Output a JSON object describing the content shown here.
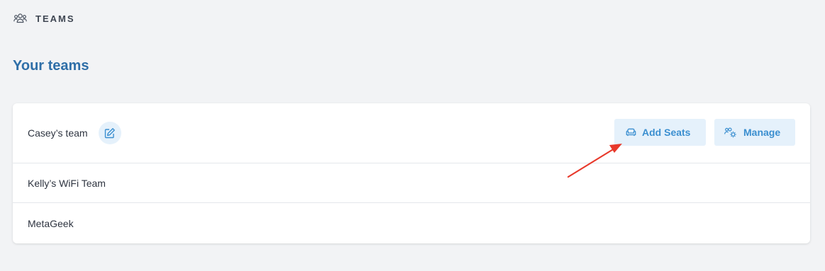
{
  "header": {
    "title": "TEAMS",
    "icon": "users-icon"
  },
  "section": {
    "title": "Your teams"
  },
  "teams": [
    {
      "name": "Casey’s team"
    },
    {
      "name": "Kelly’s WiFi Team"
    },
    {
      "name": "MetaGeek"
    }
  ],
  "actions": {
    "add_seats_label": "Add Seats",
    "add_seats_icon": "sofa-seat-icon",
    "manage_label": "Manage",
    "manage_icon": "users-gear-icon",
    "edit_icon": "edit-pencil-icon"
  },
  "colors": {
    "background": "#f2f3f5",
    "accent": "#3b8fd0",
    "heading": "#2f6fa8",
    "button_bg": "#e5f1fb",
    "annotation_arrow": "#e8392b"
  }
}
